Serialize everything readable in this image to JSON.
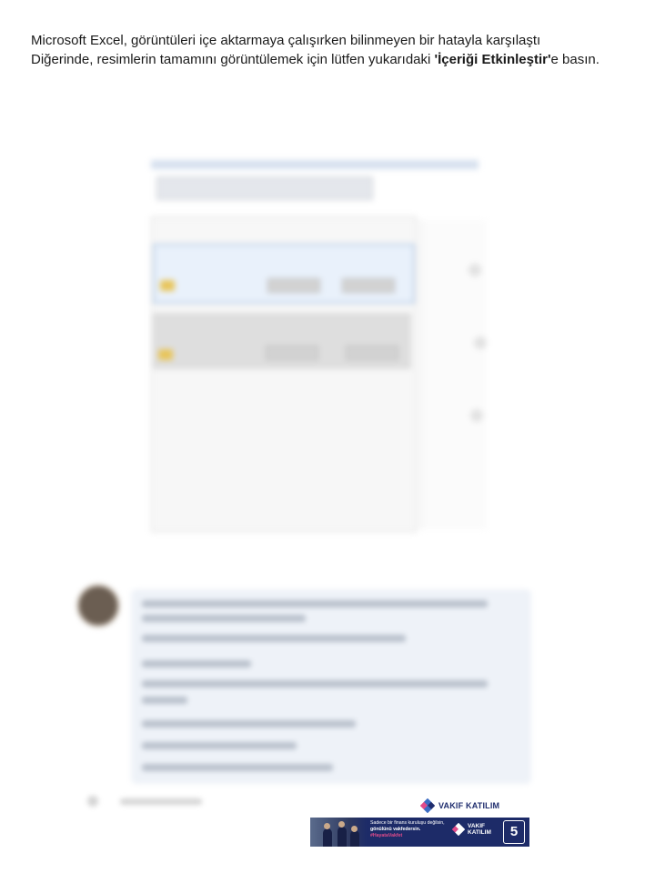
{
  "message": {
    "line1": "Microsoft Excel, görüntüleri içe aktarmaya çalışırken bilinmeyen bir hatayla karşılaştı",
    "line2_prefix": "Diğerinde, resimlerin tamamını görüntülemek için lütfen yukarıdaki ",
    "line2_bold": "'İçeriği Etkinleştir'",
    "line2_suffix": "e basın."
  },
  "ad": {
    "top_logo_text": "VAKIF KATILIM",
    "banner_line1": "Sadece bir finans kuruluşu değilsin,",
    "banner_line2": "gönülünü vakfedersin.",
    "banner_hashtag": "#HayataVakfet",
    "banner_brand_line1": "VAKIF",
    "banner_brand_line2": "KATILIM",
    "banner_badge": "5",
    "colors": {
      "navy": "#1d2b68",
      "pink": "#e14b8a",
      "blue": "#3b6cc4"
    }
  }
}
